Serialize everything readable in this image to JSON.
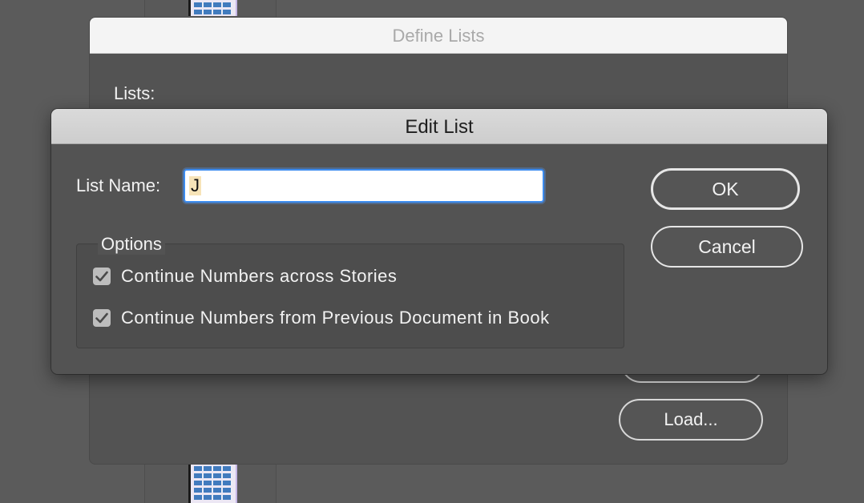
{
  "define_lists": {
    "title": "Define Lists",
    "lists_label": "Lists:",
    "load_button": "Load..."
  },
  "edit_list": {
    "title": "Edit List",
    "list_name_label": "List Name:",
    "list_name_value": "J",
    "options_legend": "Options",
    "options": [
      {
        "label": "Continue Numbers across Stories",
        "checked": true
      },
      {
        "label": "Continue Numbers from Previous Document in Book",
        "checked": true
      }
    ],
    "ok_button": "OK",
    "cancel_button": "Cancel"
  },
  "colors": {
    "background": "#5b5b5b",
    "dialog": "#535353",
    "focus_ring": "#3c8cf0"
  }
}
